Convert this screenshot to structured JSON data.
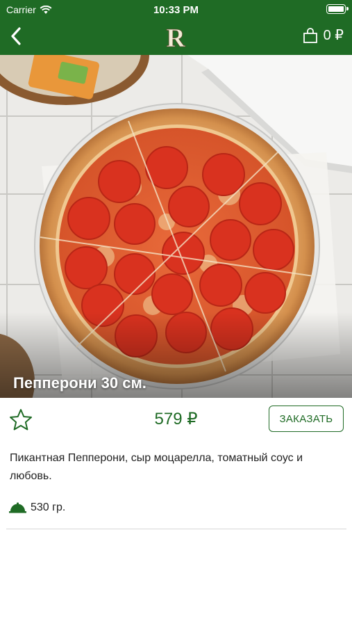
{
  "status_bar": {
    "carrier": "Carrier",
    "time": "10:33 PM"
  },
  "header": {
    "logo_letter": "R",
    "cart_count": "0 ₽"
  },
  "product": {
    "title": "Пепперони 30 см.",
    "price": "579 ₽",
    "order_label": "ЗАКАЗАТЬ",
    "description": "Пикантная Пепперони, сыр моцарелла, томатный соус и любовь.",
    "weight": "530 гр."
  },
  "colors": {
    "brand_green": "#1f6b25",
    "divider": "#d6d6d6"
  },
  "icons": [
    "wifi-icon",
    "battery-icon",
    "back-chevron-icon",
    "cart-bag-icon",
    "star-icon",
    "dish-cloche-icon"
  ]
}
